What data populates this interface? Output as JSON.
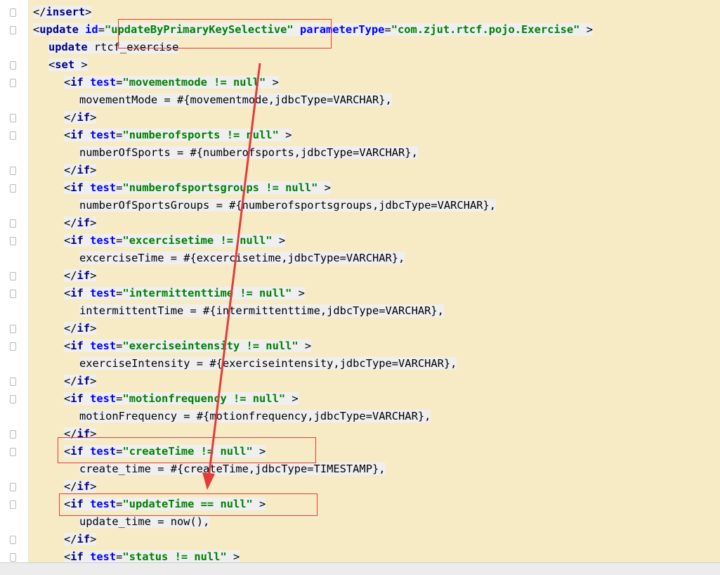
{
  "editor": {
    "lines": [
      {
        "parts": [
          {
            "c": "br",
            "t": "</"
          },
          {
            "c": "tag",
            "t": "insert"
          },
          {
            "c": "br",
            "t": ">"
          }
        ]
      },
      {
        "parts": [
          {
            "c": "br",
            "t": "<"
          },
          {
            "c": "tag",
            "t": "update "
          },
          {
            "c": "attr",
            "t": "id"
          },
          {
            "c": "br",
            "t": "="
          },
          {
            "c": "val",
            "t": "\"updateByPrimaryKeySelective\" "
          },
          {
            "c": "attr",
            "t": "parameterType"
          },
          {
            "c": "br",
            "t": "="
          },
          {
            "c": "val",
            "t": "\"com.zjut.rtcf.pojo.Exercise\" "
          },
          {
            "c": "br",
            "t": ">"
          }
        ]
      },
      {
        "parts": [
          {
            "c": "tag",
            "t": "update "
          },
          {
            "c": "txt",
            "t": "rtcf_exercise"
          }
        ]
      },
      {
        "parts": [
          {
            "c": "br",
            "t": "<"
          },
          {
            "c": "tag",
            "t": "set "
          },
          {
            "c": "br",
            "t": ">"
          }
        ]
      },
      {
        "parts": [
          {
            "c": "br",
            "t": "<"
          },
          {
            "c": "tag",
            "t": "if "
          },
          {
            "c": "attr",
            "t": "test"
          },
          {
            "c": "br",
            "t": "="
          },
          {
            "c": "val",
            "t": "\"movementmode != null\" "
          },
          {
            "c": "br",
            "t": ">"
          }
        ]
      },
      {
        "parts": [
          {
            "c": "txt",
            "t": "movementMode = #{movementmode,jdbcType=VARCHAR},"
          }
        ]
      },
      {
        "parts": [
          {
            "c": "br",
            "t": "</"
          },
          {
            "c": "tag",
            "t": "if"
          },
          {
            "c": "br",
            "t": ">"
          }
        ]
      },
      {
        "parts": [
          {
            "c": "br",
            "t": "<"
          },
          {
            "c": "tag",
            "t": "if "
          },
          {
            "c": "attr",
            "t": "test"
          },
          {
            "c": "br",
            "t": "="
          },
          {
            "c": "val",
            "t": "\"numberofsports != null\" "
          },
          {
            "c": "br",
            "t": ">"
          }
        ]
      },
      {
        "parts": [
          {
            "c": "txt",
            "t": "numberOfSports = #{numberofsports,jdbcType=VARCHAR},"
          }
        ]
      },
      {
        "parts": [
          {
            "c": "br",
            "t": "</"
          },
          {
            "c": "tag",
            "t": "if"
          },
          {
            "c": "br",
            "t": ">"
          }
        ]
      },
      {
        "parts": [
          {
            "c": "br",
            "t": "<"
          },
          {
            "c": "tag",
            "t": "if "
          },
          {
            "c": "attr",
            "t": "test"
          },
          {
            "c": "br",
            "t": "="
          },
          {
            "c": "val",
            "t": "\"numberofsportsgroups != null\" "
          },
          {
            "c": "br",
            "t": ">"
          }
        ]
      },
      {
        "parts": [
          {
            "c": "txt",
            "t": "numberOfSportsGroups = #{numberofsportsgroups,jdbcType=VARCHAR},"
          }
        ]
      },
      {
        "parts": [
          {
            "c": "br",
            "t": "</"
          },
          {
            "c": "tag",
            "t": "if"
          },
          {
            "c": "br",
            "t": ">"
          }
        ]
      },
      {
        "parts": [
          {
            "c": "br",
            "t": "<"
          },
          {
            "c": "tag",
            "t": "if "
          },
          {
            "c": "attr",
            "t": "test"
          },
          {
            "c": "br",
            "t": "="
          },
          {
            "c": "val",
            "t": "\"excercisetime != null\" "
          },
          {
            "c": "br",
            "t": ">"
          }
        ]
      },
      {
        "parts": [
          {
            "c": "txt",
            "t": "excerciseTime = #{excercisetime,jdbcType=VARCHAR},"
          }
        ]
      },
      {
        "parts": [
          {
            "c": "br",
            "t": "</"
          },
          {
            "c": "tag",
            "t": "if"
          },
          {
            "c": "br",
            "t": ">"
          }
        ]
      },
      {
        "parts": [
          {
            "c": "br",
            "t": "<"
          },
          {
            "c": "tag",
            "t": "if "
          },
          {
            "c": "attr",
            "t": "test"
          },
          {
            "c": "br",
            "t": "="
          },
          {
            "c": "val",
            "t": "\"intermittenttime != null\" "
          },
          {
            "c": "br",
            "t": ">"
          }
        ]
      },
      {
        "parts": [
          {
            "c": "txt",
            "t": "intermittentTime = #{intermittenttime,jdbcType=VARCHAR},"
          }
        ]
      },
      {
        "parts": [
          {
            "c": "br",
            "t": "</"
          },
          {
            "c": "tag",
            "t": "if"
          },
          {
            "c": "br",
            "t": ">"
          }
        ]
      },
      {
        "parts": [
          {
            "c": "br",
            "t": "<"
          },
          {
            "c": "tag",
            "t": "if "
          },
          {
            "c": "attr",
            "t": "test"
          },
          {
            "c": "br",
            "t": "="
          },
          {
            "c": "val",
            "t": "\"exerciseintensity != null\" "
          },
          {
            "c": "br",
            "t": ">"
          }
        ]
      },
      {
        "parts": [
          {
            "c": "txt",
            "t": "exerciseIntensity = #{exerciseintensity,jdbcType=VARCHAR},"
          }
        ]
      },
      {
        "parts": [
          {
            "c": "br",
            "t": "</"
          },
          {
            "c": "tag",
            "t": "if"
          },
          {
            "c": "br",
            "t": ">"
          }
        ]
      },
      {
        "parts": [
          {
            "c": "br",
            "t": "<"
          },
          {
            "c": "tag",
            "t": "if "
          },
          {
            "c": "attr",
            "t": "test"
          },
          {
            "c": "br",
            "t": "="
          },
          {
            "c": "val",
            "t": "\"motionfrequency != null\" "
          },
          {
            "c": "br",
            "t": ">"
          }
        ]
      },
      {
        "parts": [
          {
            "c": "txt",
            "t": "motionFrequency = #{motionfrequency,jdbcType=VARCHAR},"
          }
        ]
      },
      {
        "parts": [
          {
            "c": "br",
            "t": "</"
          },
          {
            "c": "tag",
            "t": "if"
          },
          {
            "c": "br",
            "t": ">"
          }
        ]
      },
      {
        "parts": [
          {
            "c": "br",
            "t": "<"
          },
          {
            "c": "tag",
            "t": "if "
          },
          {
            "c": "attr",
            "t": "test"
          },
          {
            "c": "br",
            "t": "="
          },
          {
            "c": "val",
            "t": "\"createTime != null\" "
          },
          {
            "c": "br",
            "t": ">"
          }
        ]
      },
      {
        "parts": [
          {
            "c": "txt",
            "t": "create_time = #{createTime,jdbcType=TIMESTAMP},"
          }
        ]
      },
      {
        "parts": [
          {
            "c": "br",
            "t": "</"
          },
          {
            "c": "tag",
            "t": "if"
          },
          {
            "c": "br",
            "t": ">"
          }
        ]
      },
      {
        "parts": [
          {
            "c": "br",
            "t": "<"
          },
          {
            "c": "tag",
            "t": "if "
          },
          {
            "c": "attr",
            "t": "test"
          },
          {
            "c": "br",
            "t": "="
          },
          {
            "c": "val",
            "t": "\"updateTime == null\" "
          },
          {
            "c": "br",
            "t": ">"
          }
        ]
      },
      {
        "parts": [
          {
            "c": "txt",
            "t": "update_time = now(),"
          }
        ]
      },
      {
        "parts": [
          {
            "c": "br",
            "t": "</"
          },
          {
            "c": "tag",
            "t": "if"
          },
          {
            "c": "br",
            "t": ">"
          }
        ]
      },
      {
        "parts": [
          {
            "c": "br",
            "t": "<"
          },
          {
            "c": "tag",
            "t": "if "
          },
          {
            "c": "attr",
            "t": "test"
          },
          {
            "c": "br",
            "t": "="
          },
          {
            "c": "val",
            "t": "\"status != null\" "
          },
          {
            "c": "br",
            "t": ">"
          }
        ]
      }
    ]
  },
  "annotation_color": "#e23b3b"
}
